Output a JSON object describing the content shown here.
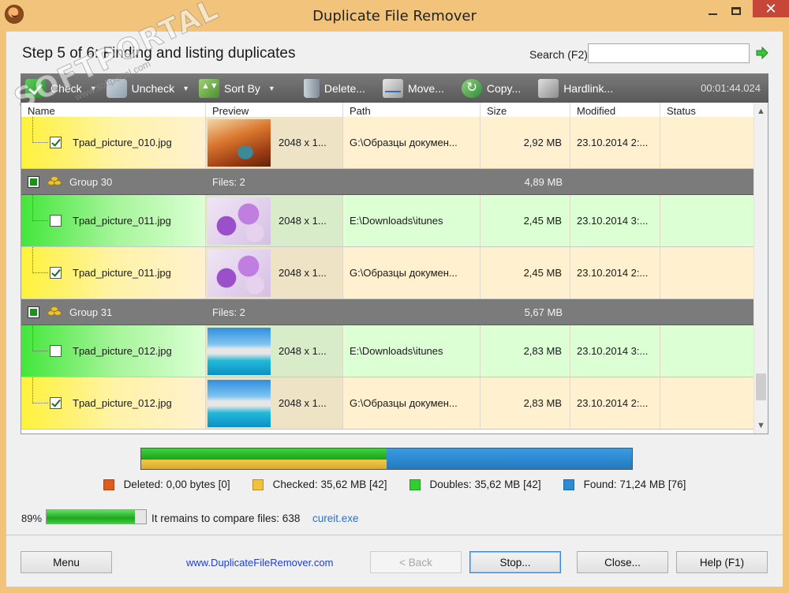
{
  "window": {
    "title": "Duplicate File Remover",
    "min_label": "",
    "close_label": "✕"
  },
  "header": {
    "step_title": "Step 5 of 6: Finding and listing duplicates",
    "search_label": "Search (F2)",
    "search_value": "",
    "search_placeholder": ""
  },
  "watermark": {
    "main": "SOFTPORTAL",
    "sub": "www.softportal.com"
  },
  "toolbar": {
    "check": "Check",
    "uncheck": "Uncheck",
    "sort_by": "Sort By",
    "delete": "Delete...",
    "move": "Move...",
    "copy": "Copy...",
    "hardlink": "Hardlink...",
    "elapsed": "00:01:44.024"
  },
  "columns": [
    "Name",
    "Preview",
    "Path",
    "Size",
    "Modified",
    "Status"
  ],
  "rows": [
    {
      "kind": "file",
      "state": "checked",
      "checked": true,
      "name": "Tpad_picture_010.jpg",
      "thumb": "canyon",
      "resolution": "2048 x 1...",
      "path": "G:\\Образцы докумен...",
      "size": "2,92 MB",
      "modified": "23.10.2014 2:...",
      "status": ""
    },
    {
      "kind": "group",
      "name": "Group 30",
      "files": "Files: 2",
      "size": "4,89 MB"
    },
    {
      "kind": "file",
      "state": "orig",
      "checked": false,
      "name": "Tpad_picture_011.jpg",
      "thumb": "flowers",
      "resolution": "2048 x 1...",
      "path": "E:\\Downloads\\itunes",
      "size": "2,45 MB",
      "modified": "23.10.2014 3:...",
      "status": ""
    },
    {
      "kind": "file",
      "state": "checked",
      "checked": true,
      "name": "Tpad_picture_011.jpg",
      "thumb": "flowers",
      "resolution": "2048 x 1...",
      "path": "G:\\Образцы докумен...",
      "size": "2,45 MB",
      "modified": "23.10.2014 2:...",
      "status": ""
    },
    {
      "kind": "group",
      "name": "Group 31",
      "files": "Files: 2",
      "size": "5,67 MB"
    },
    {
      "kind": "file",
      "state": "orig",
      "checked": false,
      "name": "Tpad_picture_012.jpg",
      "thumb": "resort",
      "resolution": "2048 x 1...",
      "path": "E:\\Downloads\\itunes",
      "size": "2,83 MB",
      "modified": "23.10.2014 3:...",
      "status": ""
    },
    {
      "kind": "file",
      "state": "checked",
      "checked": true,
      "name": "Tpad_picture_012.jpg",
      "thumb": "resort",
      "resolution": "2048 x 1...",
      "path": "G:\\Образцы докумен...",
      "size": "2,83 MB",
      "modified": "23.10.2014 2:...",
      "status": ""
    }
  ],
  "summary": {
    "checked_fraction": 0.5,
    "doubles_fraction": 0.5,
    "legend": [
      {
        "label": "Deleted: 0,00 bytes [0]",
        "color": "#e05a1c"
      },
      {
        "label": "Checked: 35,62 MB [42]",
        "color": "#f2c33a"
      },
      {
        "label": "Doubles: 35,62 MB [42]",
        "color": "#2fcf2f"
      },
      {
        "label": "Found: 71,24 MB [76]",
        "color": "#2a8bd6"
      }
    ]
  },
  "progress": {
    "percent_label": "89%",
    "fraction": 0.89,
    "remain_text": "It remains to compare files: 638",
    "current_file": "cureit.exe"
  },
  "footer": {
    "menu": "Menu",
    "site": "www.DuplicateFileRemover.com",
    "back": "< Back",
    "stop": "Stop...",
    "close": "Close...",
    "help": "Help (F1)"
  }
}
